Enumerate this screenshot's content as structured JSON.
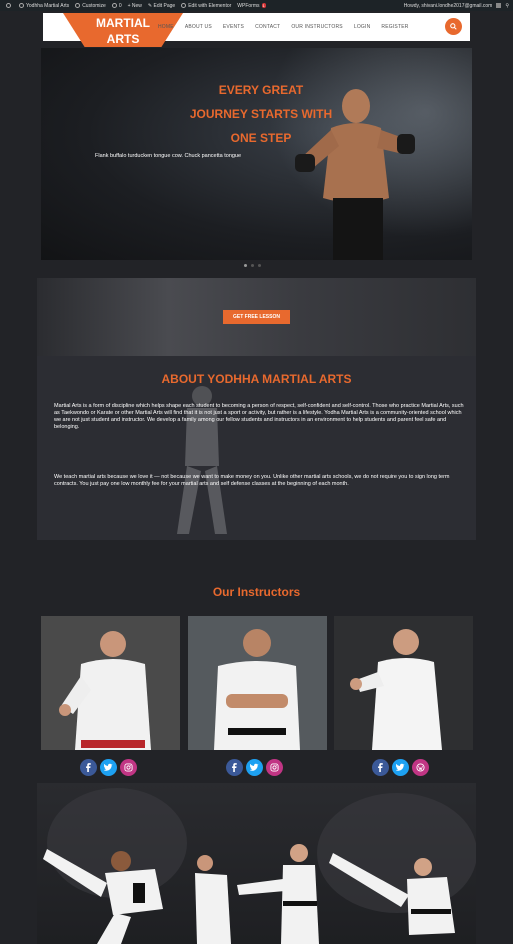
{
  "adminbar": {
    "site_name": "Yodhha Martial Arts",
    "customize": "Customize",
    "comments": "0",
    "new": "New",
    "edit_page": "Edit Page",
    "elementor": "Edit with Elementor",
    "wpforms": "WPForms",
    "wpforms_badge": "1",
    "howdy": "Howdy, shivani.londhe2017@gmail.com"
  },
  "header": {
    "logo_line1": "MARTIAL",
    "logo_line2": "ARTS",
    "nav": [
      "HOME",
      "ABOUT US",
      "EVENTS",
      "CONTACT",
      "OUR INSTRUCTORS",
      "LOGIN",
      "REGISTER"
    ]
  },
  "hero": {
    "headline_1": "EVERY GREAT",
    "headline_2": "JOURNEY STARTS WITH",
    "headline_3": "ONE STEP",
    "subtext": "Flank buffalo turducken tongue cow. Chuck pancetta tongue"
  },
  "cta": {
    "button": "GET FREE LESSON"
  },
  "about": {
    "title": "ABOUT YODHHA MARTIAL ARTS",
    "para1": "Martial Arts is a form of discipline which helps shape each student to becoming a person of respect, self-confident and self-control. Those who practice Martial Arts, such as Taekwondo or Karate or other Martial Arts will find that it is not just a sport or activity, but rather is a lifestyle. Yodha Martial Arts is a community-oriented school which we are not just student and instructor. We develop a family among our fellow students and instructors in an environment to help students and parent feel safe and belonging.",
    "para2": "We teach martial arts because we love it — not because we want to make money on you. Unlike other martial arts schools, we do not require you to sign long term contracts. You just pay one low monthly fee for your martial arts and self defense classes at the beginning of each month."
  },
  "instructors": {
    "title": "Our Instructors"
  },
  "colors": {
    "accent": "#e8692e",
    "background": "#222327",
    "panel": "#2c2d33"
  }
}
